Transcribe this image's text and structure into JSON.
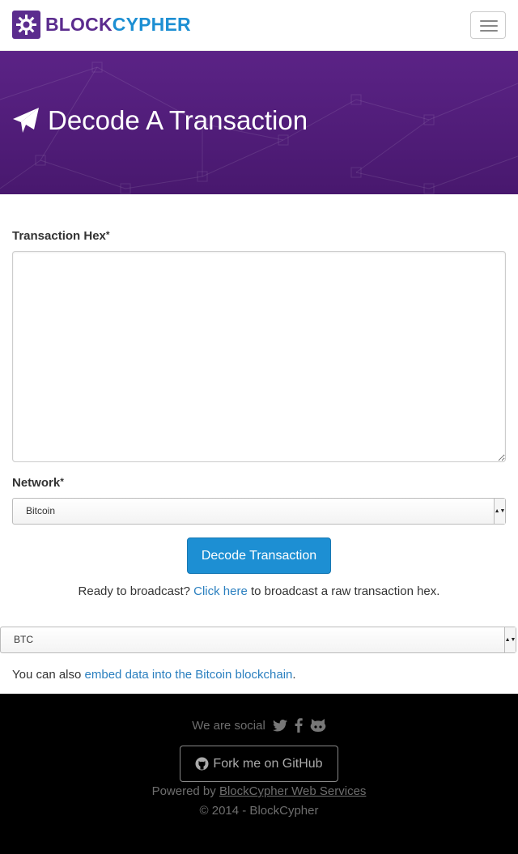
{
  "navbar": {
    "brand_part1": "BLOCK",
    "brand_part2": "CYPHER",
    "menu_icon": "hamburger-icon",
    "brand_icon": "gear-logo-icon"
  },
  "hero": {
    "title": "Decode A Transaction",
    "icon": "paper-plane-icon"
  },
  "form": {
    "hex_label": "Transaction Hex",
    "hex_required": "*",
    "hex_value": "",
    "network_label": "Network",
    "network_required": "*",
    "network_selected": "Bitcoin",
    "submit_label": "Decode Transaction"
  },
  "broadcast": {
    "prefix": "Ready to broadcast?",
    "link": "Click here",
    "suffix": "to broadcast a raw transaction hex."
  },
  "coin_select": {
    "selected": "BTC"
  },
  "embed": {
    "prefix": "You can also",
    "link": "embed data into the Bitcoin blockchain",
    "suffix": "."
  },
  "footer": {
    "social_text": "We are social",
    "social_icons": [
      "twitter-icon",
      "facebook-icon",
      "github-icon"
    ],
    "github_button": "Fork me on GitHub",
    "powered_prefix": "Powered by",
    "powered_link": "BlockCypher Web Services",
    "copyright": "© 2014 - BlockCypher"
  },
  "colors": {
    "brand_purple": "#5b2c8e",
    "brand_blue": "#1d8fd3",
    "link": "#2a7fbf",
    "footer_bg": "#000000"
  }
}
